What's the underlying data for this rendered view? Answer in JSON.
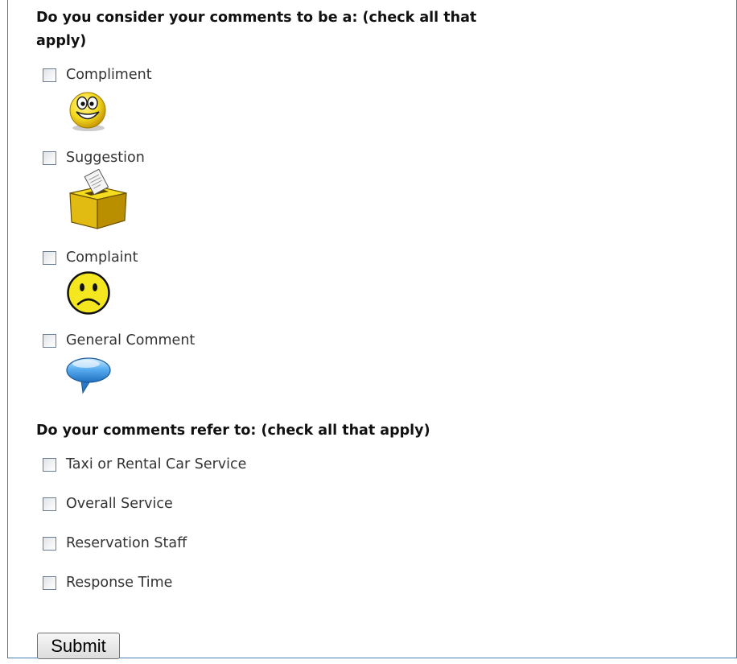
{
  "form": {
    "question1": "Do you consider your comments to be a: (check all that apply)",
    "type_options": [
      {
        "label": "Compliment",
        "icon": "smiley-face-icon",
        "checked": false
      },
      {
        "label": "Suggestion",
        "icon": "suggestion-box-icon",
        "checked": false
      },
      {
        "label": "Complaint",
        "icon": "sad-face-icon",
        "checked": false
      },
      {
        "label": "General Comment",
        "icon": "speech-bubble-icon",
        "checked": false
      }
    ],
    "question2": "Do your comments refer to: (check all that apply)",
    "refer_options": [
      {
        "label": "Taxi or Rental Car Service",
        "checked": false
      },
      {
        "label": "Overall Service",
        "checked": false
      },
      {
        "label": "Reservation Staff",
        "checked": false
      },
      {
        "label": "Response Time",
        "checked": false
      }
    ],
    "submit_label": "Submit"
  },
  "colors": {
    "frame_border": "#4a7fb5",
    "icon_yellow": "#f5dc1f",
    "bubble_blue": "#4d9fe0"
  }
}
